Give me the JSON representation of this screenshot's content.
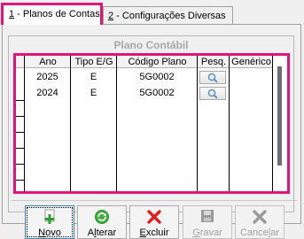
{
  "tabs": [
    {
      "mnemonic": "1",
      "label": " - Planos de Contas"
    },
    {
      "mnemonic": "2",
      "label": " - Configurações Diversas"
    }
  ],
  "group_title": "Plano Contábil",
  "columns": [
    "Ano",
    "Tipo E/G",
    "Código Plano",
    "Pesq.",
    "Genérico"
  ],
  "rows": [
    {
      "ano": "2025",
      "tipo": "E",
      "codigo": "5G0002",
      "pesq_icon": "search-icon",
      "generico": ""
    },
    {
      "ano": "2024",
      "tipo": "E",
      "codigo": "5G0002",
      "pesq_icon": "search-icon",
      "generico": ""
    }
  ],
  "buttons": {
    "novo": {
      "accel": "N",
      "rest": "ovo",
      "icon": "plus-icon",
      "enabled": true
    },
    "alterar": {
      "pre": "A",
      "accel": "l",
      "rest": "terar",
      "icon": "refresh-icon",
      "enabled": true
    },
    "excluir": {
      "accel": "E",
      "rest": "xcluir",
      "icon": "red-x-icon",
      "enabled": true
    },
    "gravar": {
      "accel": "G",
      "rest": "ravar",
      "icon": "save-icon",
      "enabled": false
    },
    "cancelar": {
      "pre": "Cance",
      "accel": "l",
      "rest": "ar",
      "icon": "gray-x-icon",
      "enabled": false
    }
  },
  "colors": {
    "highlight": "#e0147a"
  }
}
